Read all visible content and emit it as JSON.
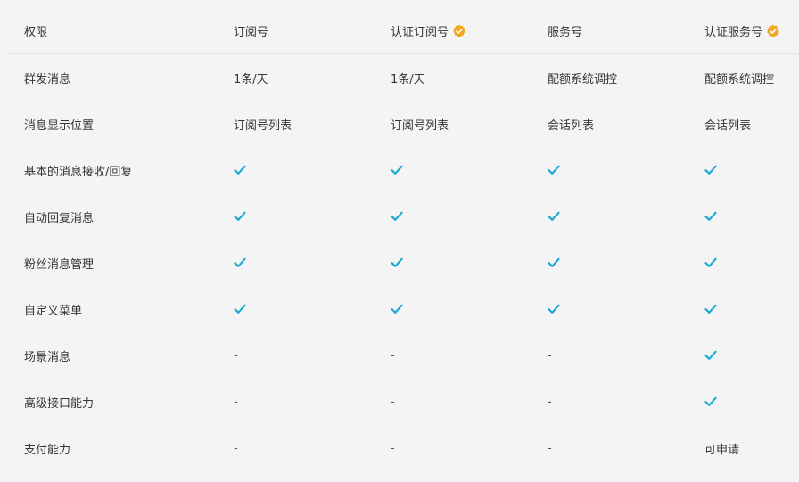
{
  "header": {
    "col0": "权限",
    "col1": "订阅号",
    "col2": "认证订阅号",
    "col3": "服务号",
    "col4": "认证服务号"
  },
  "rows": [
    {
      "label": "群发消息",
      "v1": "1条/天",
      "v2": "1条/天",
      "v3": "配额系统调控",
      "v4": "配额系统调控"
    },
    {
      "label": "消息显示位置",
      "v1": "订阅号列表",
      "v2": "订阅号列表",
      "v3": "会话列表",
      "v4": "会话列表"
    },
    {
      "label": "基本的消息接收/回复",
      "v1": "check",
      "v2": "check",
      "v3": "check",
      "v4": "check"
    },
    {
      "label": "自动回复消息",
      "v1": "check",
      "v2": "check",
      "v3": "check",
      "v4": "check"
    },
    {
      "label": "粉丝消息管理",
      "v1": "check",
      "v2": "check",
      "v3": "check",
      "v4": "check"
    },
    {
      "label": "自定义菜单",
      "v1": "check",
      "v2": "check",
      "v3": "check",
      "v4": "check"
    },
    {
      "label": "场景消息",
      "v1": "-",
      "v2": "-",
      "v3": "-",
      "v4": "check"
    },
    {
      "label": "高级接口能力",
      "v1": "-",
      "v2": "-",
      "v3": "-",
      "v4": "check"
    },
    {
      "label": "支付能力",
      "v1": "-",
      "v2": "-",
      "v3": "-",
      "v4": "可申请"
    }
  ],
  "colors": {
    "check": "#1aa9d6",
    "badge": "#f2a51d",
    "divider": "#e3e3e3",
    "background": "#f4f4f4"
  },
  "icons": {
    "verified": "verified-badge-icon",
    "check": "check-icon"
  }
}
